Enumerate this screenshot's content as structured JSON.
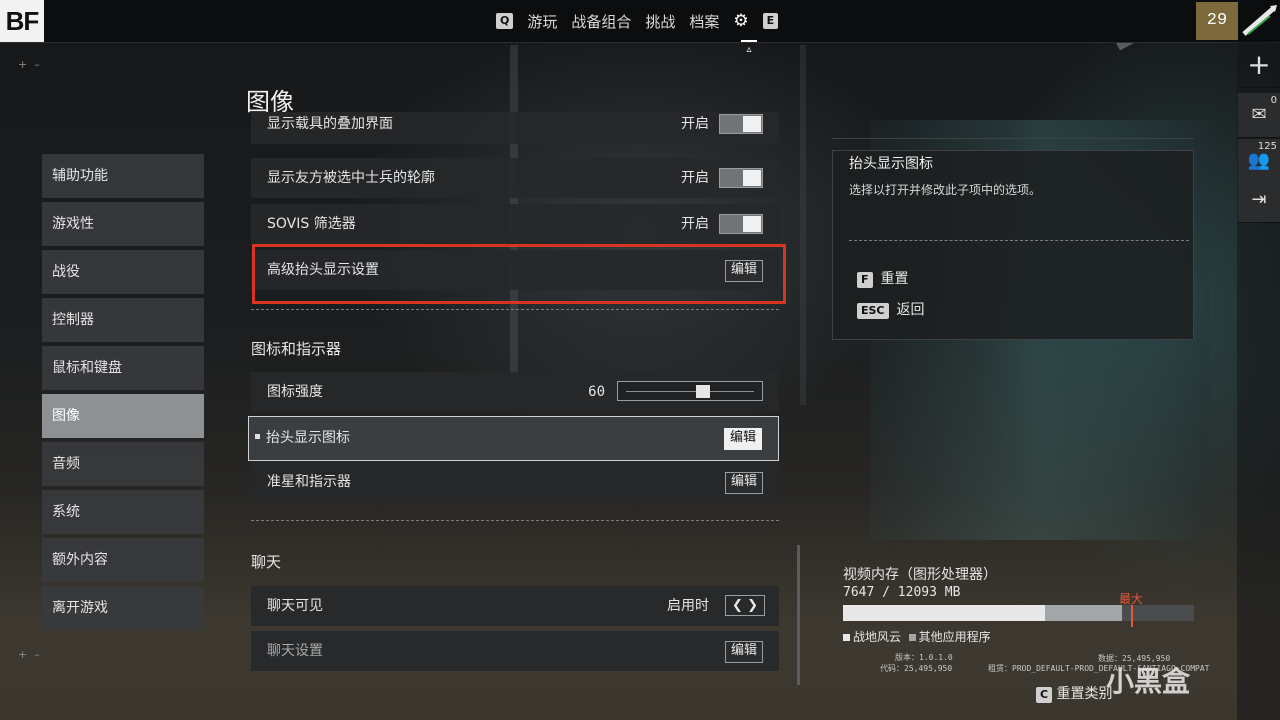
{
  "app": {
    "logo": "BF"
  },
  "topnav": {
    "left_key": "Q",
    "items": [
      "游玩",
      "战备组合",
      "挑战",
      "档案"
    ],
    "right_key": "E",
    "active_icon": "gear-icon"
  },
  "player": {
    "rank": "29"
  },
  "rail": {
    "mail_count": "0",
    "squad_count": "125"
  },
  "page_title": "图像",
  "sidebar": {
    "items": [
      "辅助功能",
      "游戏性",
      "战役",
      "控制器",
      "鼠标和键盘",
      "图像",
      "音频",
      "系统",
      "额外内容",
      "离开游戏"
    ],
    "active_index": 5
  },
  "settings": {
    "rows_top": [
      {
        "label": "显示载具的叠加界面",
        "value": "开启",
        "control": "toggle",
        "on": true
      },
      {
        "label": "显示友方被选中士兵的轮廓",
        "value": "开启",
        "control": "toggle",
        "on": true
      },
      {
        "label": "SOVIS 筛选器",
        "value": "开启",
        "control": "toggle",
        "on": true
      },
      {
        "label": "高级抬头显示设置",
        "control": "edit",
        "button": "编辑"
      }
    ],
    "section_icons": {
      "title": "图标和指示器",
      "icon_strength": {
        "label": "图标强度",
        "value": "60",
        "level": 0.6
      },
      "hud_icons": {
        "label": "抬头显示图标",
        "button": "编辑"
      },
      "crosshair": {
        "label": "准星和指示器",
        "button": "编辑"
      }
    },
    "section_chat": {
      "title": "聊天",
      "chat_visible": {
        "label": "聊天可见",
        "value": "启用时"
      },
      "chat_settings": {
        "label": "聊天设置",
        "button": "编辑"
      }
    }
  },
  "info": {
    "title": "抬头显示图标",
    "description": "选择以打开并修改此子项中的选项。",
    "actions": [
      {
        "key": "F",
        "label": "重置"
      },
      {
        "key": "ESC",
        "label": "返回"
      }
    ]
  },
  "vram": {
    "title": "视频内存（图形处理器）",
    "usage_text": "7647 / 12093 MB",
    "used_fraction": 0.575,
    "other_fraction": 0.22,
    "max_label": "最大",
    "legend_game": "战地风云",
    "legend_other": "其他应用程序",
    "version": "版本：1.0.1.0",
    "code": "代码：25,495,950",
    "data": "数据：25,495,950",
    "tenant": "租赁：PROD_DEFAULT-PROD_DEFAULT-SANTIAGO-COMPAT"
  },
  "bottom": {
    "key": "C",
    "label": "重置类别"
  },
  "watermark": "小黑盒",
  "colors": {
    "highlight": "#d9341f",
    "max": "#e4573c"
  }
}
